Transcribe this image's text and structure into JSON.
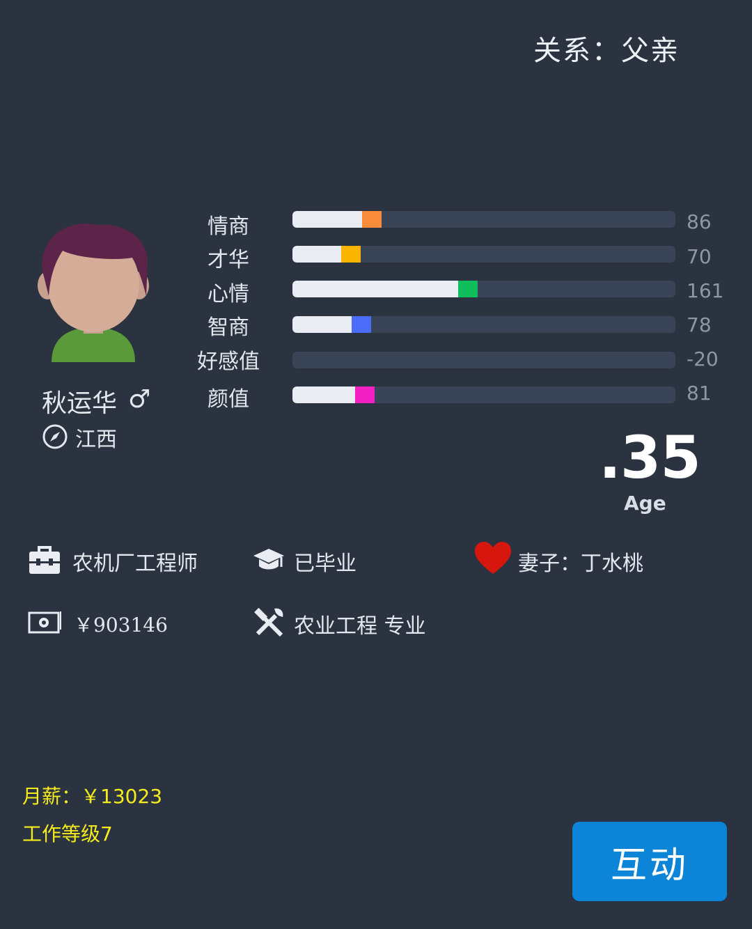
{
  "header": {
    "relation": "关系：父亲"
  },
  "profile": {
    "name": "秋运华",
    "gender_symbol": "♂",
    "location": "江西"
  },
  "stats": [
    {
      "label": "情商",
      "value": "86",
      "fill_fraction": 0.233,
      "color": "#f98c3a"
    },
    {
      "label": "才华",
      "value": "70",
      "fill_fraction": 0.178,
      "color": "#fbb400"
    },
    {
      "label": "心情",
      "value": "161",
      "fill_fraction": 0.484,
      "color": "#0fbd5b"
    },
    {
      "label": "智商",
      "value": "78",
      "fill_fraction": 0.205,
      "color": "#4a6cf7"
    },
    {
      "label": "好感值",
      "value": "-20",
      "fill_fraction": 0.0,
      "color": "#3a4457"
    },
    {
      "label": "颜值",
      "value": "81",
      "fill_fraction": 0.215,
      "color": "#f21fc2"
    }
  ],
  "age": {
    "value": ".35",
    "label": "Age"
  },
  "info": {
    "job": "农机厂工程师",
    "education": "已毕业",
    "spouse": "妻子：丁水桃",
    "money": "￥903146",
    "major": "农业工程 专业"
  },
  "footer": {
    "salary": "月薪：￥13023",
    "work_level": "工作等级7"
  },
  "actions": {
    "interact_label": "互动"
  },
  "colors": {
    "background": "#2b3341",
    "track": "#3a4457",
    "button": "#0c84d8",
    "highlight_text": "#f6ec1c",
    "heart": "#d7160e"
  }
}
